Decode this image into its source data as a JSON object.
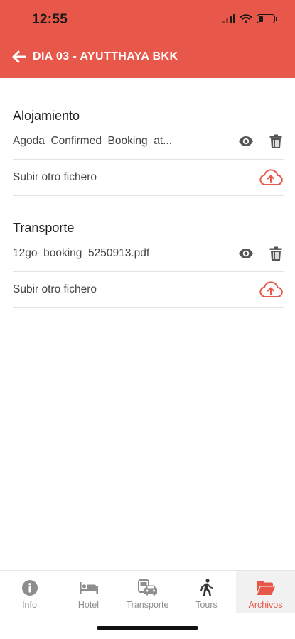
{
  "status_bar": {
    "time": "12:55"
  },
  "header": {
    "title": "DIA 03 - AYUTTHAYA BKK"
  },
  "colors": {
    "accent": "#e8584a",
    "icon_gray": "#555555"
  },
  "sections": [
    {
      "title": "Alojamiento",
      "file": {
        "name": "Agoda_Confirmed_Booking_at...",
        "icons": [
          "eye-icon",
          "trash-icon"
        ]
      },
      "upload_label": "Subir otro fichero"
    },
    {
      "title": "Transporte",
      "file": {
        "name": "12go_booking_5250913.pdf",
        "icons": [
          "eye-icon",
          "trash-icon"
        ]
      },
      "upload_label": "Subir otro fichero"
    }
  ],
  "tabs": [
    {
      "label": "Info",
      "icon": "info-icon",
      "active": false
    },
    {
      "label": "Hotel",
      "icon": "bed-icon",
      "active": false
    },
    {
      "label": "Transporte",
      "icon": "bus-car-icon",
      "active": false
    },
    {
      "label": "Tours",
      "icon": "walking-person-icon",
      "active": false
    },
    {
      "label": "Archivos",
      "icon": "folder-open-icon",
      "active": true
    }
  ]
}
